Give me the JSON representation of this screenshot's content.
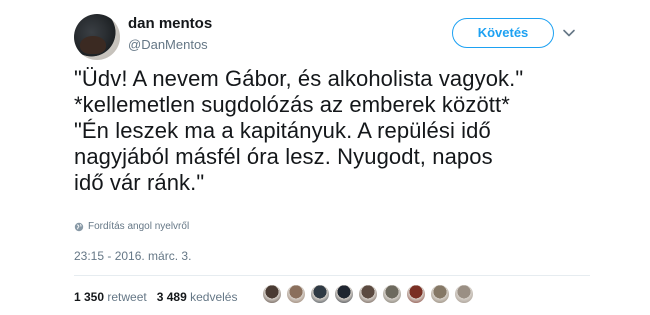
{
  "user": {
    "display_name": "dan mentos",
    "handle": "@DanMentos",
    "avatar_icon": "profile-avatar"
  },
  "follow_button": {
    "label": "Követés",
    "color": "#1da1f2"
  },
  "more_menu_icon": "chevron-down-icon",
  "tweet": {
    "lines": [
      "\"Üdv! A nevem Gábor, és alkoholista vagyok.\"",
      "*kellemetlen sugdolózás az emberek között*",
      "\"Én leszek ma a kapitányuk. A repülési idő",
      "nagyjából másfél óra lesz. Nyugodt, napos",
      "idő vár ránk.\""
    ],
    "translate_label": "Fordítás angol nyelvről",
    "translate_icon": "globe-icon",
    "timestamp": "23:15 - 2016. márc. 3."
  },
  "stats": {
    "retweets_count": "1 350",
    "retweets_label": "retweet",
    "likes_count": "3 489",
    "likes_label": "kedvelés"
  },
  "likers": [
    {
      "color": "#4a3b33"
    },
    {
      "color": "#8a6f5c"
    },
    {
      "color": "#2f3a44"
    },
    {
      "color": "#1f2630"
    },
    {
      "color": "#5b4a40"
    },
    {
      "color": "#6d6a5e"
    },
    {
      "color": "#7a2f24"
    },
    {
      "color": "#857866"
    },
    {
      "color": "#9a8f84"
    }
  ]
}
